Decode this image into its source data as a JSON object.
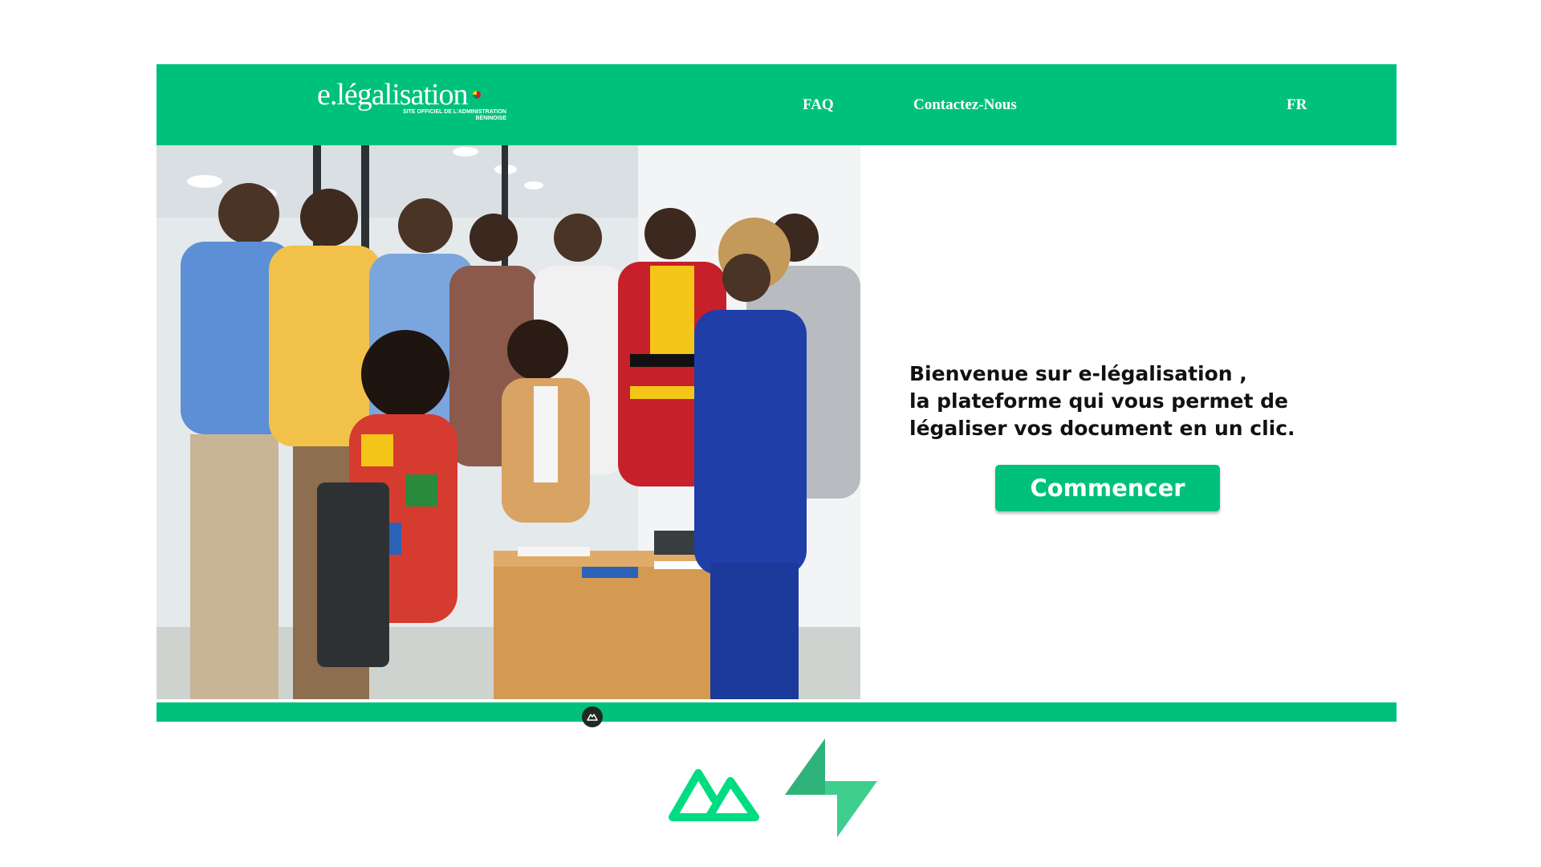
{
  "header": {
    "logo_text": "e.légalisation",
    "logo_subtitle_line1": "SITE OFFICIEL DE L'ADMINISTRATION",
    "logo_subtitle_line2": "BÉNINOISE",
    "nav": {
      "faq": "FAQ",
      "contact": "Contactez-Nous",
      "language": "FR"
    }
  },
  "hero": {
    "image_label": "photo",
    "welcome_line1": "Bienvenue sur e-légalisation ,",
    "welcome_line2": "la plateforme qui vous permet de",
    "welcome_line3": "légaliser vos document en un clic.",
    "cta_label": "Commencer"
  },
  "colors": {
    "brand_green": "#00c17c",
    "text_dark": "#111111",
    "nuxt_green": "#00dc82",
    "supabase_green": "#3ecf8e"
  },
  "icons": {
    "footer_badge": "nuxt-small-icon",
    "bottom_left": "nuxt-logo-icon",
    "bottom_right": "supabase-logo-icon"
  }
}
